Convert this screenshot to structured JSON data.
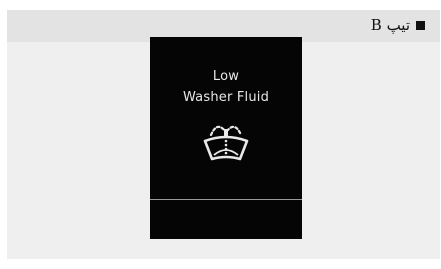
{
  "header": {
    "type_label": "تیپ B"
  },
  "display": {
    "line1": "Low",
    "line2": "Washer Fluid",
    "icon": "washer-fluid-icon"
  }
}
